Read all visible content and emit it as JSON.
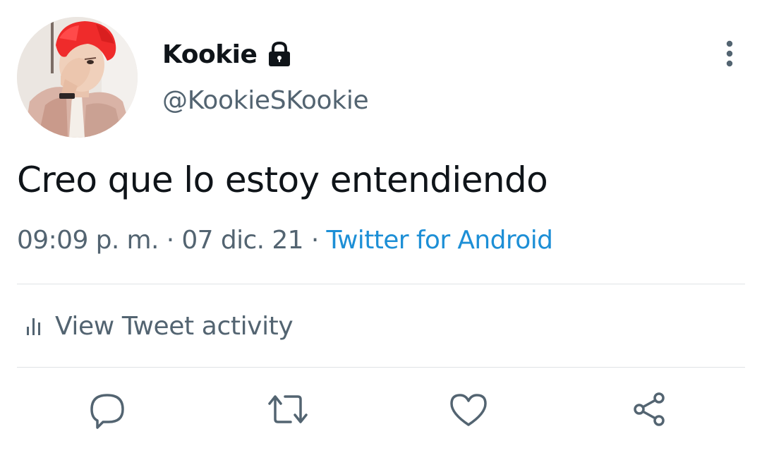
{
  "tweet": {
    "author": {
      "display_name": "Kookie",
      "handle": "@KookieSKookie",
      "protected_icon": "lock-icon",
      "avatar": "profile-photo-avatar"
    },
    "text": "Creo que lo estoy entendiendo",
    "time": "09:09 p. m.",
    "separator": "·",
    "date": "07 dic. 21",
    "source": "Twitter for Android",
    "activity_label": "View Tweet activity",
    "activity_icon": "bar-chart-icon",
    "more_icon": "more-vertical-icon",
    "actions": [
      {
        "name": "reply",
        "icon": "reply-icon"
      },
      {
        "name": "retweet",
        "icon": "retweet-icon"
      },
      {
        "name": "like",
        "icon": "heart-icon"
      },
      {
        "name": "share",
        "icon": "share-icon"
      }
    ]
  },
  "colors": {
    "text_primary": "#0f1419",
    "text_secondary": "#536471",
    "link": "#1d8fd6",
    "divider": "#dfe3e6",
    "icon": "#536471"
  }
}
